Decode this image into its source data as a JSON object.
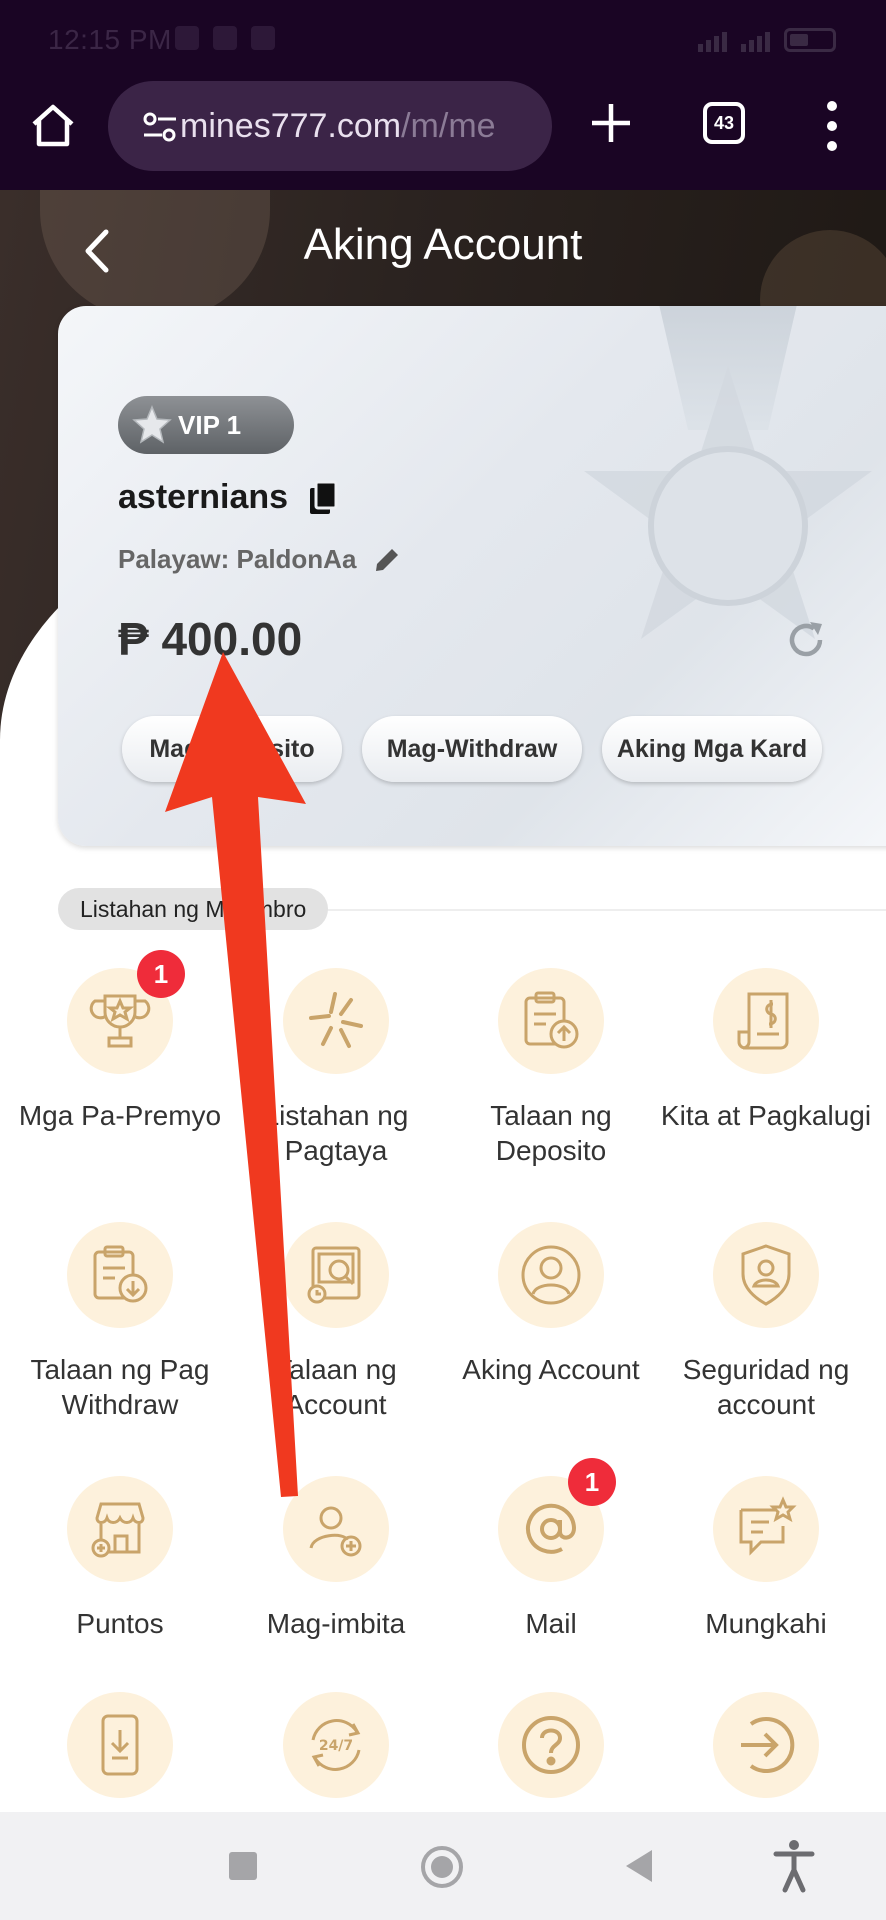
{
  "status_bar": {
    "time": "12:15 PM"
  },
  "browser": {
    "url_host": "mines777.com",
    "url_path": "/m/me",
    "tab_count": "43"
  },
  "header": {
    "title": "Aking Account"
  },
  "account": {
    "vip": "VIP 1",
    "username": "asternians",
    "nickname": "Palayaw: PaldonAa",
    "balance": "₱ 400.00",
    "buttons": [
      {
        "label": "Mag-Deposito"
      },
      {
        "label": "Mag-Withdraw"
      },
      {
        "label": "Aking Mga Kard"
      }
    ]
  },
  "members": {
    "section_title": "Listahan ng Miyembro",
    "items": [
      {
        "label": "Mga Pa-Premyo",
        "icon": "trophy-icon",
        "badge": "1"
      },
      {
        "label": "Listahan ng Pagtaya",
        "icon": "bet-list-icon"
      },
      {
        "label": "Talaan ng Deposito",
        "icon": "deposit-record-icon"
      },
      {
        "label": "Kita at Pagkalugi",
        "icon": "profit-loss-icon"
      },
      {
        "label": "Talaan ng Pag Withdraw",
        "icon": "withdraw-record-icon"
      },
      {
        "label": "Talaan ng Account",
        "icon": "account-record-icon"
      },
      {
        "label": "Aking Account",
        "icon": "user-icon"
      },
      {
        "label": "Seguridad ng account",
        "icon": "shield-user-icon"
      },
      {
        "label": "Puntos",
        "icon": "store-icon"
      },
      {
        "label": "Mag-imbita",
        "icon": "invite-user-icon"
      },
      {
        "label": "Mail",
        "icon": "mail-icon",
        "badge": "1"
      },
      {
        "label": "Mungkahi",
        "icon": "feedback-icon"
      },
      {
        "label": "",
        "icon": "download-app-icon"
      },
      {
        "label": "",
        "icon": "support-24-7-icon"
      },
      {
        "label": "",
        "icon": "help-icon"
      },
      {
        "label": "",
        "icon": "logout-icon"
      }
    ]
  },
  "colors": {
    "accent": "#c9a46a",
    "icon_bg": "#fdf1dc",
    "badge": "#ef2c3a",
    "arrow": "#f0391f"
  }
}
